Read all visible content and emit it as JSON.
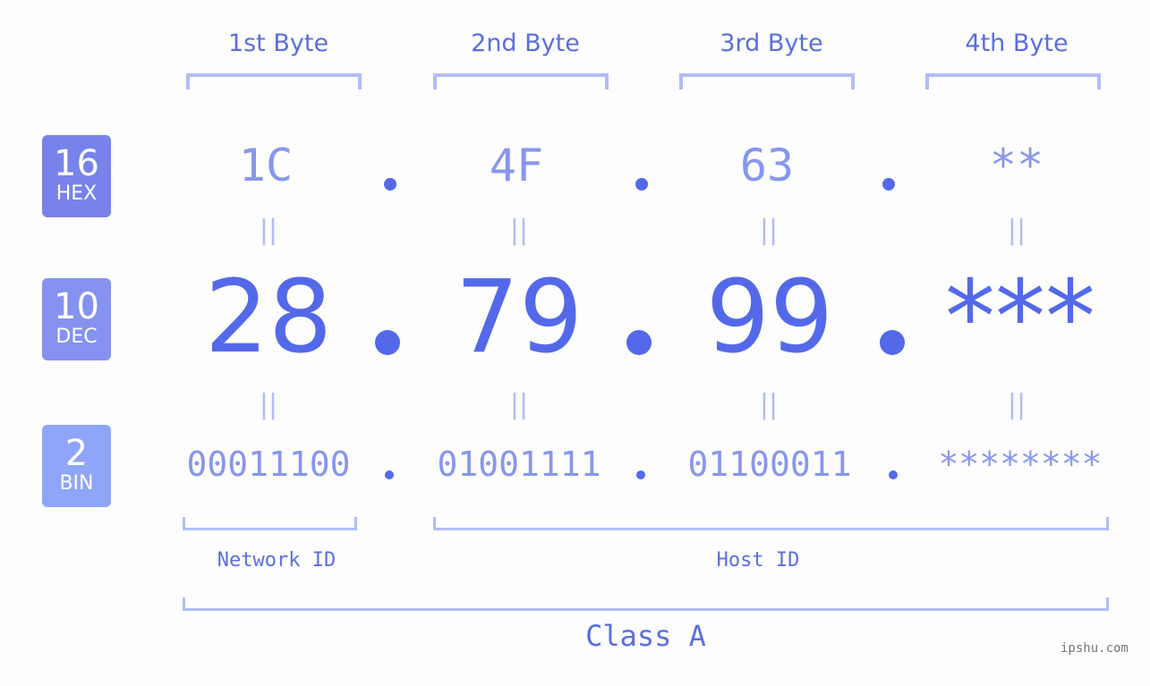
{
  "byte_headers": [
    "1st Byte",
    "2nd Byte",
    "3rd Byte",
    "4th Byte"
  ],
  "rows": {
    "hex": {
      "base": "16",
      "label": "HEX",
      "values": [
        "1C",
        "4F",
        "63",
        "**"
      ],
      "color": "#7783ea"
    },
    "dec": {
      "base": "10",
      "label": "DEC",
      "values": [
        "28",
        "79",
        "99",
        "***"
      ],
      "color": "#8592f0"
    },
    "bin": {
      "base": "2",
      "label": "BIN",
      "values": [
        "00011100",
        "01001111",
        "01100011",
        "********"
      ],
      "color": "#8fa5f8"
    }
  },
  "equals_symbol": "||",
  "network_id_label": "Network ID",
  "host_id_label": "Host ID",
  "class_label": "Class A",
  "watermark": "ipshu.com"
}
